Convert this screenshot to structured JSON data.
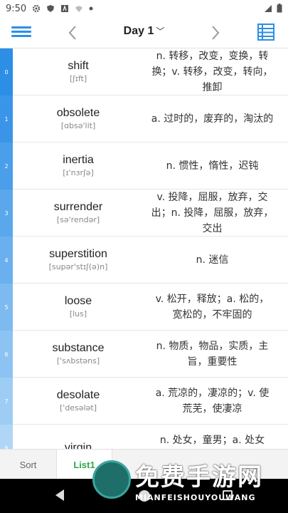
{
  "status": {
    "time": "9:50",
    "icons": [
      "gear-icon",
      "shield-icon",
      "a-icon",
      "wifi-icon",
      "dot-icon"
    ],
    "right_icons": [
      "signal-icon",
      "battery-icon"
    ]
  },
  "app_bar": {
    "title": "Day 1",
    "chevron": "﹀",
    "menu_icon": "hamburger-menu-icon",
    "prev_icon": "chevron-left-icon",
    "next_icon": "chevron-right-icon",
    "list_icon": "list-view-icon",
    "accent_color": "#2d8ee6"
  },
  "words": [
    {
      "index": "0",
      "word": "shift",
      "phonetic": "[ʃɪft]",
      "definition": "n. 转移，改变，变换，转换；v. 转移，改变，转向，推卸",
      "color": "#2d8ee6"
    },
    {
      "index": "1",
      "word": "obsolete",
      "phonetic": "[ɑbsə'lit]",
      "definition": "a. 过时的，废弃的，淘汰的",
      "color": "#3a95e8"
    },
    {
      "index": "2",
      "word": "inertia",
      "phonetic": "[ɪ'nɜrʃə]",
      "definition": "n. 惯性，惰性，迟钝",
      "color": "#4a9eea"
    },
    {
      "index": "3",
      "word": "surrender",
      "phonetic": "[sə'rendər]",
      "definition": "v. 投降，屈服，放弃，交出；n. 投降，屈服，放弃，交出",
      "color": "#5aa7ec"
    },
    {
      "index": "4",
      "word": "superstition",
      "phonetic": "[supər'stɪʃ(ə)n]",
      "definition": "n. 迷信",
      "color": "#6bb0ee"
    },
    {
      "index": "5",
      "word": "loose",
      "phonetic": "[lus]",
      "definition": "v. 松开，释放；a. 松的，宽松的，不牢固的",
      "color": "#7cbaf0"
    },
    {
      "index": "6",
      "word": "substance",
      "phonetic": "['sʌbstəns]",
      "definition": "n. 物质，物品，实质，主旨，重要性",
      "color": "#8dc3f2"
    },
    {
      "index": "7",
      "word": "desolate",
      "phonetic": "['desələt]",
      "definition": "a. 荒凉的，凄凉的；v. 使荒芜，使凄凉",
      "color": "#9ecdf4"
    },
    {
      "index": "8",
      "word": "virgin",
      "phonetic": "",
      "definition": "n. 处女，童男；a. 处女的，",
      "color": "#afd6f6"
    }
  ],
  "tabs": [
    {
      "label": "Sort",
      "active": false
    },
    {
      "label": "List1",
      "active": true
    }
  ],
  "watermark": {
    "text": "免费手游网",
    "sub": "MIANFEISHOUYOUWANG"
  }
}
